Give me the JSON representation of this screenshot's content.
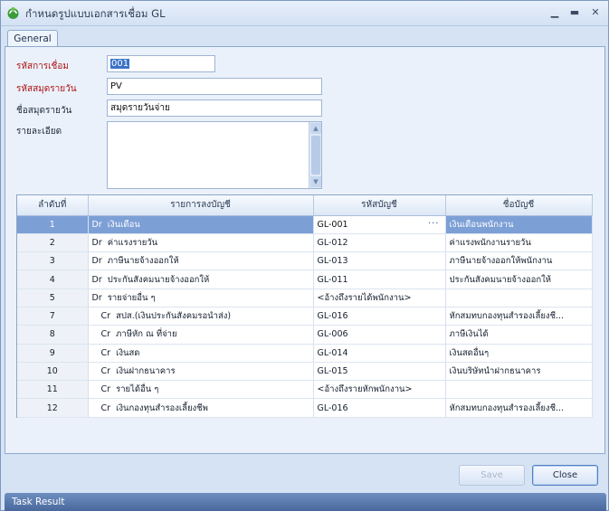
{
  "window": {
    "title": "กำหนดรูปแบบเอกสารเชื่อม GL"
  },
  "tabs": [
    {
      "label": "General"
    }
  ],
  "form": {
    "code_label": "รหัสการเชื่อม",
    "code_value": "001",
    "journal_code_label": "รหัสสมุดรายวัน",
    "journal_code_value": "PV",
    "journal_name_label": "ชื่อสมุดรายวัน",
    "journal_name_value": "สมุดรายวันจ่าย",
    "detail_label": "รายละเอียด",
    "detail_value": ""
  },
  "grid": {
    "columns": [
      "ลำดับที่",
      "รายการลงบัญชี",
      "รหัสบัญชี",
      "ชื่อบัญชี"
    ],
    "rows": [
      {
        "no": "1",
        "side": "Dr",
        "desc": "เงินเดือน",
        "code": "GL-001",
        "name": "เงินเดือนพนักงาน",
        "selected": true
      },
      {
        "no": "2",
        "side": "Dr",
        "desc": "ค่าแรงรายวัน",
        "code": "GL-012",
        "name": "ค่าแรงพนักงานรายวัน"
      },
      {
        "no": "3",
        "side": "Dr",
        "desc": "ภาษีนายจ้างออกให้",
        "code": "GL-013",
        "name": "ภาษีนายจ้างออกให้พนักงาน"
      },
      {
        "no": "4",
        "side": "Dr",
        "desc": "ประกันสังคมนายจ้างออกให้",
        "code": "GL-011",
        "name": "ประกันสังคมนายจ้างออกให้"
      },
      {
        "no": "5",
        "side": "Dr",
        "desc": "รายจ่ายอื่น ๆ",
        "code": "<อ้างถึงรายได้พนักงาน>",
        "name": ""
      },
      {
        "no": "7",
        "side": "Cr",
        "desc": "สปส.(เงินประกันสังคมรอนำส่ง)",
        "code": "GL-016",
        "name": "หักสมทบกองทุนสำรองเลี้ยงชี..."
      },
      {
        "no": "8",
        "side": "Cr",
        "desc": "ภาษีหัก ณ ที่จ่าย",
        "code": "GL-006",
        "name": "ภาษีเงินได้"
      },
      {
        "no": "9",
        "side": "Cr",
        "desc": "เงินสด",
        "code": "GL-014",
        "name": "เงินสดอื่นๆ"
      },
      {
        "no": "10",
        "side": "Cr",
        "desc": "เงินฝากธนาคาร",
        "code": "GL-015",
        "name": "เงินบริษัทนำฝากธนาคาร"
      },
      {
        "no": "11",
        "side": "Cr",
        "desc": "รายได้อื่น ๆ",
        "code": "<อ้างถึงรายหักพนักงาน>",
        "name": ""
      },
      {
        "no": "12",
        "side": "Cr",
        "desc": "เงินกองทุนสำรองเลี้ยงชีพ",
        "code": "GL-016",
        "name": "หักสมทบกองทุนสำรองเลี้ยงชี..."
      }
    ]
  },
  "buttons": {
    "save": "Save",
    "close": "Close"
  },
  "task_result": "Task Result",
  "colors": {
    "selected_row": "#7c9fd6",
    "required_label": "#b01515",
    "task_bar": "#48689d"
  }
}
